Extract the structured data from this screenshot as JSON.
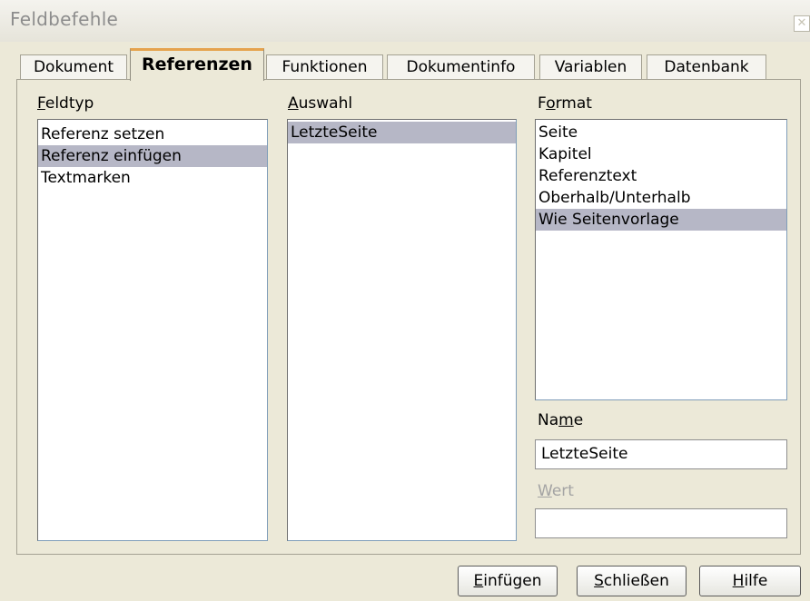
{
  "window": {
    "title": "Feldbefehle",
    "close_icon": "close-icon"
  },
  "tabs": [
    {
      "label": "Dokument",
      "active": false
    },
    {
      "label": "Referenzen",
      "active": true
    },
    {
      "label": "Funktionen",
      "active": false
    },
    {
      "label": "Dokumentinfo",
      "active": false
    },
    {
      "label": "Variablen",
      "active": false
    },
    {
      "label": "Datenbank",
      "active": false
    }
  ],
  "feldtyp": {
    "label_first": "F",
    "label_rest": "eldtyp",
    "items": [
      "Referenz setzen",
      "Referenz einfügen",
      "Textmarken"
    ],
    "selected": "Referenz einfügen"
  },
  "auswahl": {
    "label_first": "A",
    "label_rest": "uswahl",
    "items": [
      "LetzteSeite"
    ],
    "selected": "LetzteSeite"
  },
  "format": {
    "label_before": "F",
    "label_u": "o",
    "label_after": "rmat",
    "items": [
      "Seite",
      "Kapitel",
      "Referenztext",
      "Oberhalb/Unterhalb",
      "Wie Seitenvorlage"
    ],
    "selected": "Wie Seitenvorlage"
  },
  "name": {
    "label_before": "Na",
    "label_u": "m",
    "label_after": "e",
    "value": "LetzteSeite"
  },
  "wert": {
    "label_first": "W",
    "label_rest": "ert",
    "value": ""
  },
  "buttons": {
    "insert": {
      "first": "E",
      "rest": "infügen"
    },
    "close": {
      "first": "S",
      "rest": "chließen"
    },
    "help": {
      "first": "H",
      "rest": "ilfe"
    }
  }
}
